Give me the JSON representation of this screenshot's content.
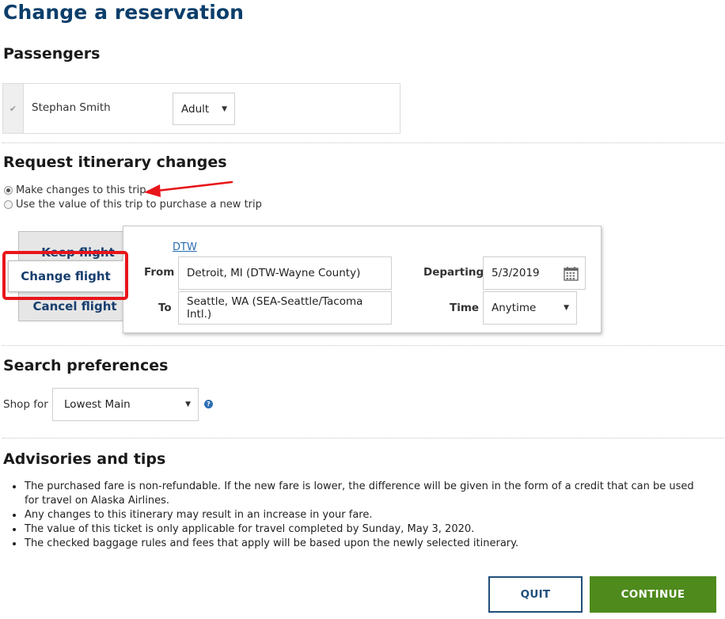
{
  "page": {
    "title": "Change a reservation"
  },
  "passengers": {
    "heading": "Passengers",
    "list": [
      {
        "name": "Stephan Smith",
        "type": "Adult"
      }
    ]
  },
  "itinerary": {
    "heading": "Request itinerary changes",
    "options": [
      {
        "label": "Make changes to this trip",
        "selected": true
      },
      {
        "label": "Use the value of this trip to purchase a new trip",
        "selected": false
      }
    ],
    "tabs": {
      "keep": "Keep flight",
      "change": "Change flight",
      "cancel": "Cancel flight"
    },
    "active_tab": "Change flight",
    "segment_link": "DTW",
    "from_label": "From",
    "from_value": "Detroit, MI (DTW-Wayne County)",
    "to_label": "To",
    "to_value": "Seattle, WA (SEA-Seattle/Tacoma Intl.)",
    "departing_label": "Departing",
    "departing_value": "5/3/2019",
    "time_label": "Time",
    "time_value": "Anytime"
  },
  "search": {
    "heading": "Search preferences",
    "shop_for_label": "Shop for",
    "shop_for_value": "Lowest Main",
    "help_icon": "?"
  },
  "advisories": {
    "heading": "Advisories and tips",
    "items": [
      "The purchased fare is non-refundable. If the new fare is lower, the difference will be given in the form of a credit that can be used for travel on Alaska Airlines.",
      "Any changes to this itinerary may result in an increase in your fare.",
      "The value of this ticket is only applicable for travel completed by Sunday, May 3, 2020.",
      "The checked baggage rules and fees that apply will be based upon the newly selected itinerary."
    ]
  },
  "actions": {
    "quit": "QUIT",
    "continue": "CONTINUE"
  },
  "colors": {
    "title": "#0b3e6b",
    "tab_text": "#173e6d",
    "link": "#2a6db0",
    "continue_bg": "#4e8a1c",
    "quit_border": "#1f4e7a",
    "annotation_red": "#e8151b",
    "help_icon": "#2c6fb3"
  },
  "icons": {
    "checkbox": "checkbox-checked-icon",
    "calendar": "calendar-icon",
    "caret": "caret-down-icon",
    "help": "help-icon",
    "arrow": "red-arrow-annotation"
  }
}
